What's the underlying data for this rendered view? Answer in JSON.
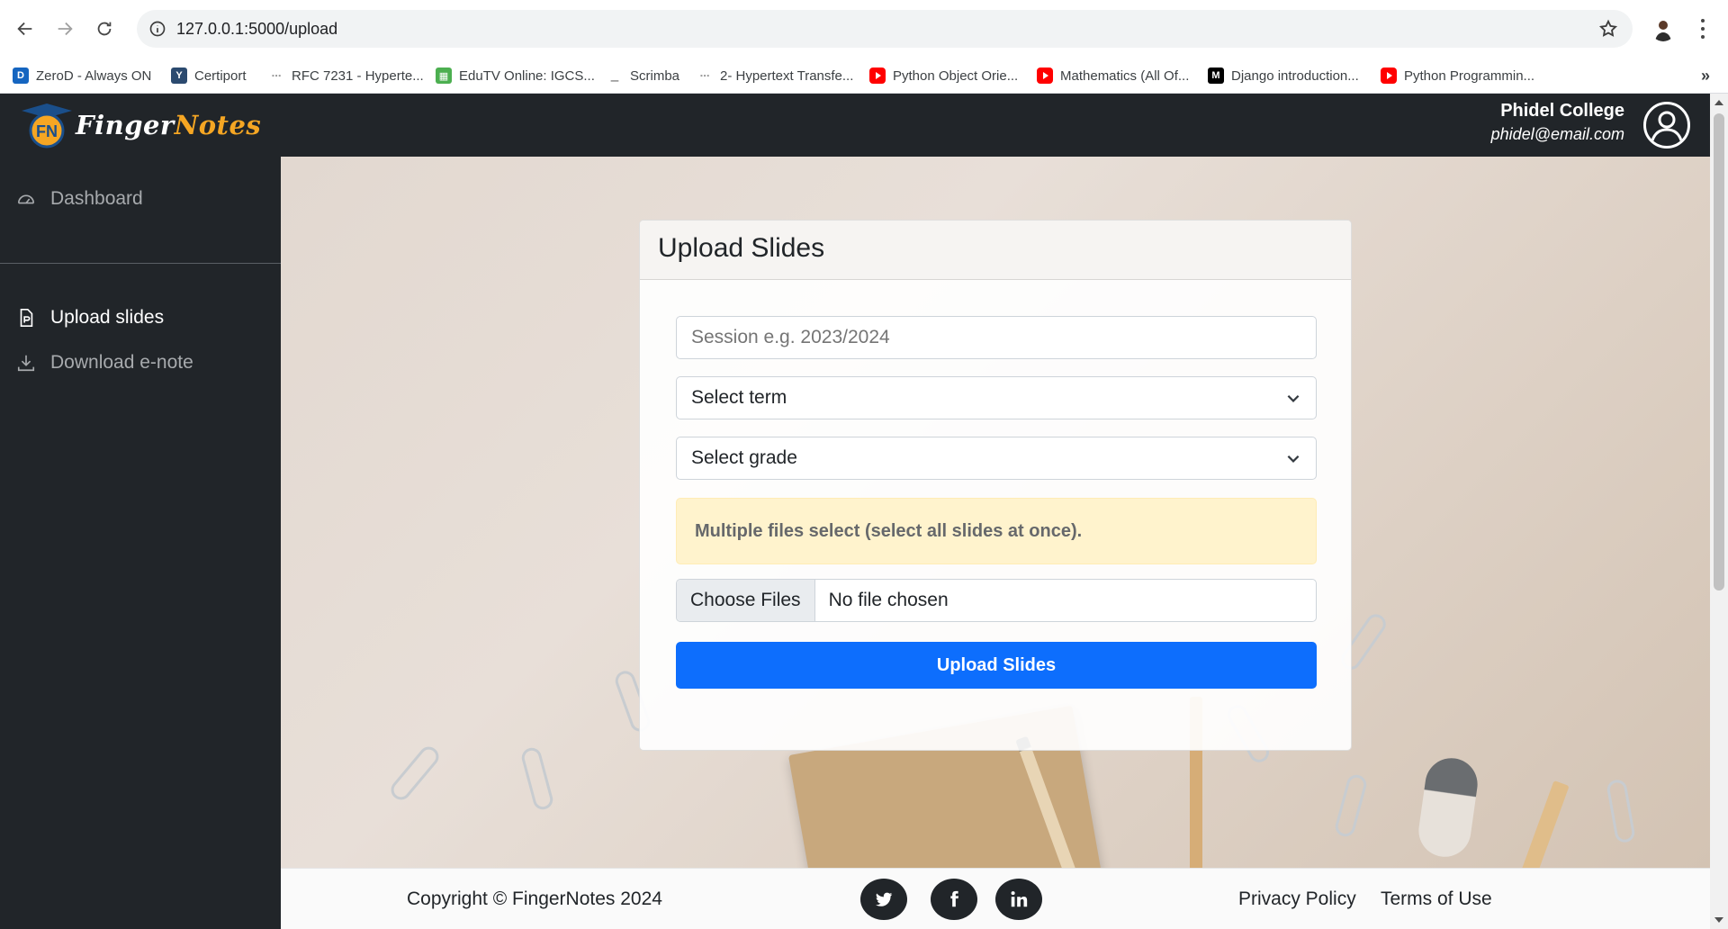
{
  "browser": {
    "url": "127.0.0.1:5000/upload",
    "bookmarks": [
      {
        "label": "ZeroD - Always ON",
        "icon": "zerod-icon",
        "color": "#1565c0"
      },
      {
        "label": "Certiport",
        "icon": "certiport-icon",
        "color": "#2b4a6f"
      },
      {
        "label": "RFC 7231 - Hyperte...",
        "icon": "rfc-icon",
        "color": "#9e9e9e"
      },
      {
        "label": "EduTV Online: IGCS...",
        "icon": "edutv-icon",
        "color": "#4caf50"
      },
      {
        "label": "Scrimba",
        "icon": "scrimba-icon",
        "color": "#9e9e9e"
      },
      {
        "label": "2- Hypertext Transfe...",
        "icon": "http-doc-icon",
        "color": "#9e9e9e"
      },
      {
        "label": "Python Object Orie...",
        "icon": "youtube-icon",
        "color": "#ff0000"
      },
      {
        "label": "Mathematics (All Of...",
        "icon": "youtube-icon",
        "color": "#ff0000"
      },
      {
        "label": "Django introduction...",
        "icon": "medium-icon",
        "color": "#000000"
      },
      {
        "label": "Python Programmin...",
        "icon": "youtube-icon",
        "color": "#ff0000"
      }
    ],
    "more_label": "»"
  },
  "app": {
    "logo": {
      "part1": "Finger",
      "part2": "Notes",
      "badge": "FN"
    },
    "user": {
      "name": "Phidel College",
      "email": "phidel@email.com"
    },
    "sidebar": {
      "items": [
        {
          "label": "Dashboard",
          "icon": "speedometer-icon",
          "active": false
        },
        {
          "label": "Upload slides",
          "icon": "file-icon",
          "active": true
        },
        {
          "label": "Download e-note",
          "icon": "download-icon",
          "active": false
        }
      ]
    },
    "card": {
      "title": "Upload Slides",
      "session_placeholder": "Session e.g. 2023/2024",
      "term_select": "Select term",
      "grade_select": "Select grade",
      "alert": "Multiple files select (select all slides at once).",
      "choose_files": "Choose Files",
      "no_file": "No file chosen",
      "submit": "Upload Slides"
    },
    "footer": {
      "copyright": "Copyright © FingerNotes 2024",
      "social": [
        "twitter-icon",
        "facebook-icon",
        "linkedin-icon"
      ],
      "privacy": "Privacy Policy",
      "terms": "Terms of Use"
    },
    "colors": {
      "navbar": "#212529",
      "primary_button": "#0d6efd",
      "alert_bg": "#fff3cd",
      "logo_accent": "#f5a623"
    }
  }
}
